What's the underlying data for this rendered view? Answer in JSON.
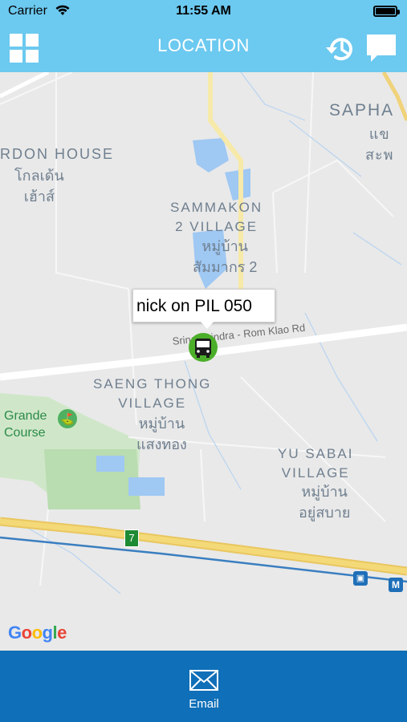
{
  "status_bar": {
    "carrier": "Carrier",
    "time": "11:55 AM"
  },
  "nav": {
    "title": "LOCATION",
    "menu_icon": "grid-icon",
    "history_icon": "history-icon",
    "chat_icon": "chat-icon"
  },
  "map": {
    "labels": {
      "saphan": "SAPHA",
      "saphan_thai": "แข\nสะพ",
      "garden_house": "RDON HOUSE",
      "garden_house_thai": "โกลเด้น\nเฮ้าส์",
      "sammakon": "SAMMAKON\n2 VILLAGE",
      "sammakon_thai": "หมู่บ้าน\nสัมมากร 2",
      "saeng_thong": "SAENG THONG\nVILLAGE",
      "saeng_thong_thai": "หมู่บ้าน\nแสงทอง",
      "yu_sabai": "YU SABAI\nVILLAGE",
      "yu_sabai_thai": "หมู่บ้าน\nอยู่สบาย",
      "road": "Srinakarindra - Rom Klao Rd",
      "golf": "Grande\nCourse",
      "route_shield": "7",
      "metro": "M"
    },
    "marker_label": "nick on PIL 050",
    "attribution": "Google"
  },
  "bottom": {
    "email_label": "Email"
  },
  "colors": {
    "header": "#6cc9f0",
    "footer": "#0f6fb8",
    "marker": "#4caf2a"
  }
}
